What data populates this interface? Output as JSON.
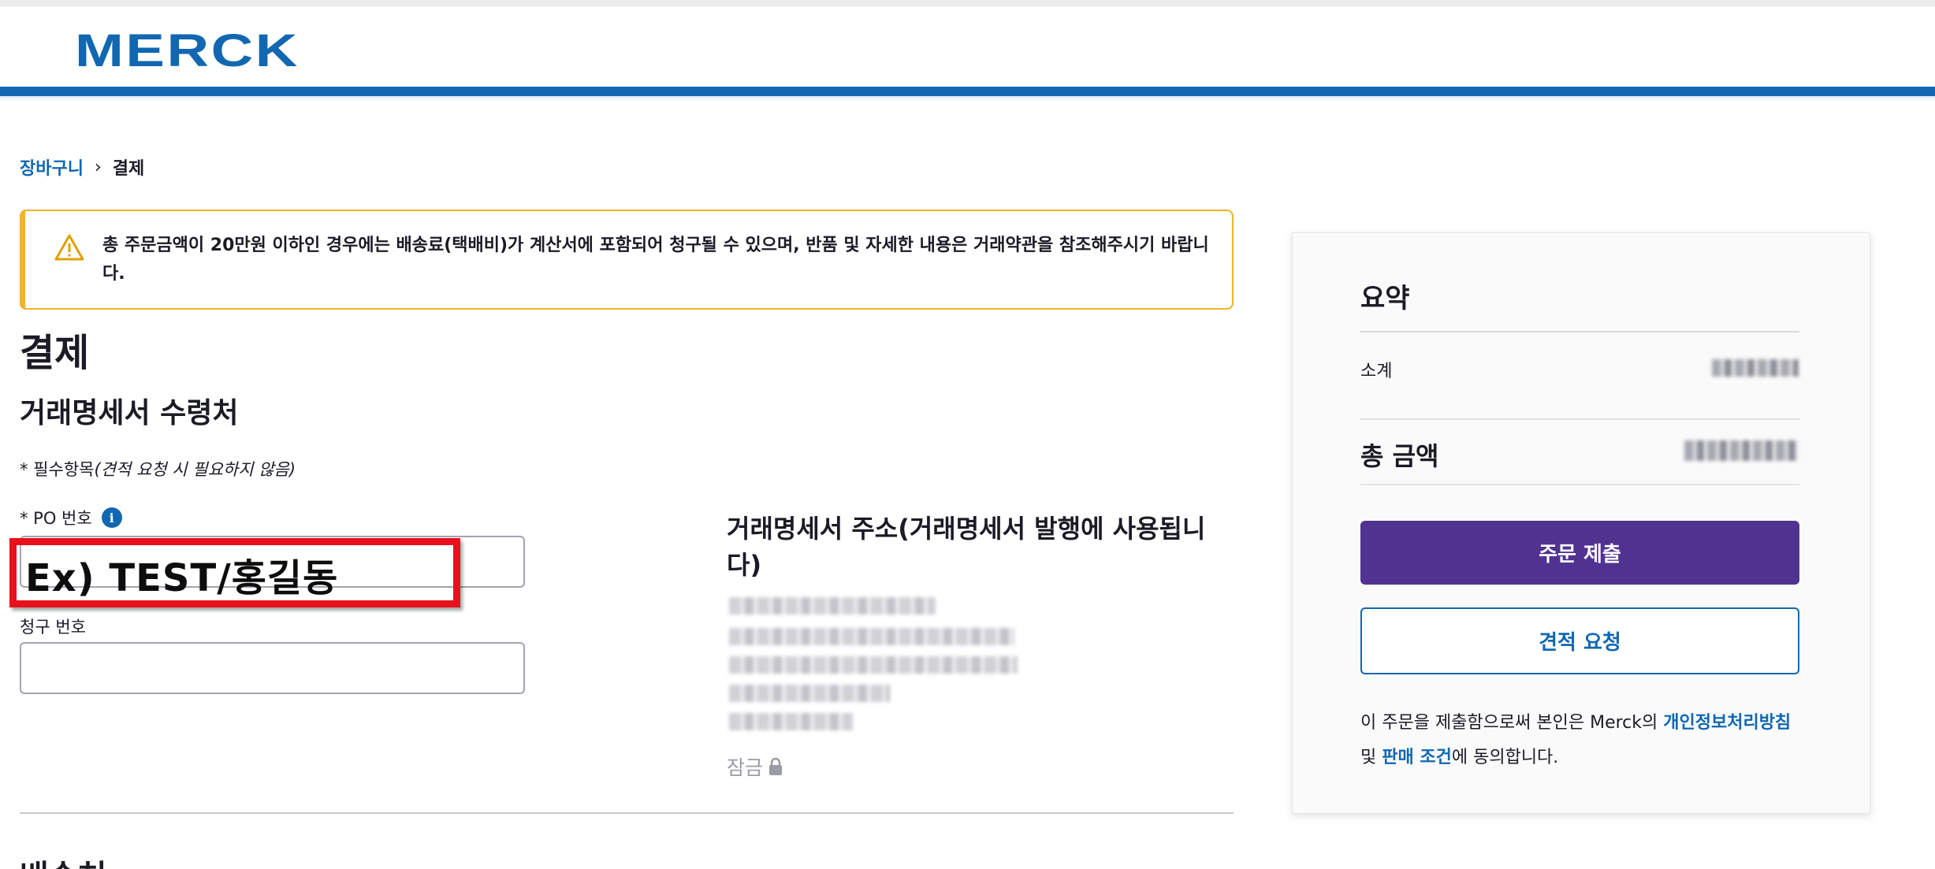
{
  "brand": {
    "logo_text": "MERCK",
    "accent": "#1167b1",
    "primary_button": "#503291",
    "warning": "#f0b429",
    "highlight": "#e8101b"
  },
  "breadcrumb": {
    "cart": "장바구니",
    "separator": "›",
    "current": "결제"
  },
  "alert": {
    "icon": "warning-triangle-icon",
    "message": "총 주문금액이 20만원 이하인 경우에는 배송료(택배비)가 계산서에 포함되어 청구될 수 있으며, 반품 및 자세한 내용은 거래약관을 참조해주시기 바랍니다."
  },
  "page_title": "결제",
  "invoice_section": {
    "title": "거래명세서 수령처",
    "required_prefix": "* 필수항목",
    "required_note": "(견적 요청 시 필요하지 않음)",
    "po_label": "* PO 번호",
    "po_info_icon": "i",
    "po_example": "Ex) TEST/홍길동",
    "billing_label": "청구 번호",
    "billing_value": ""
  },
  "address": {
    "title": "거래명세서 주소(거래명세서 발행에 사용됩니다)",
    "locked_label": "잠금"
  },
  "shipping": {
    "title": "배송처"
  },
  "summary": {
    "title": "요약",
    "subtotal_label": "소계",
    "total_label": "총 금액",
    "submit_button": "주문 제출",
    "quote_button": "견적 요청",
    "consent_prefix": "이 주문을 제출함으로써 본인은 Merck의 ",
    "privacy_link": "개인정보처리방침",
    "consent_and": " 및 ",
    "terms_link": "판매 조건",
    "consent_suffix": "에 동의합니다."
  }
}
